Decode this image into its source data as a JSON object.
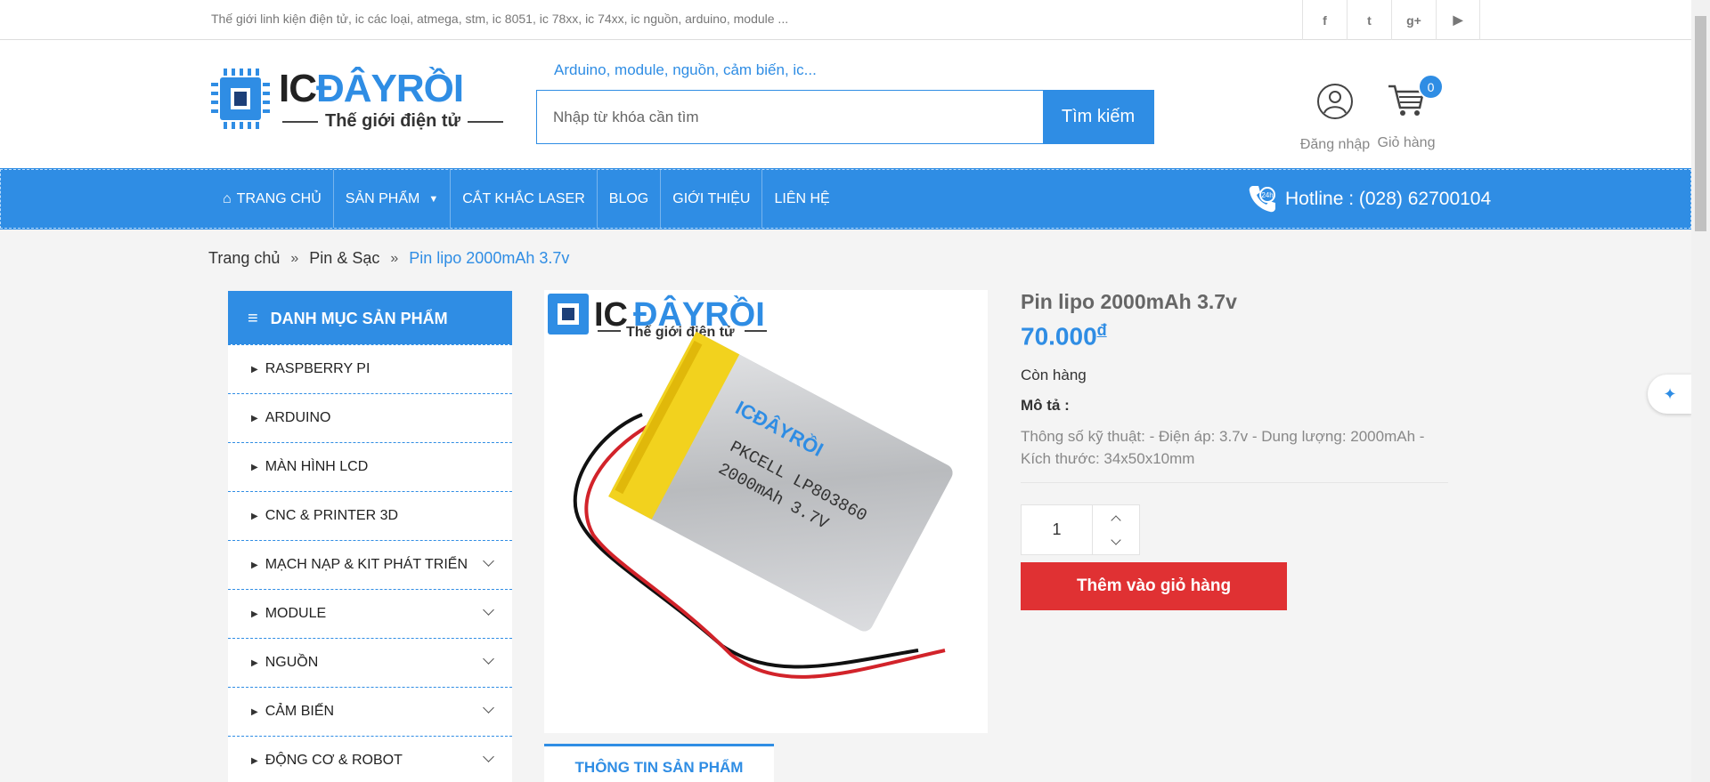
{
  "topbar": {
    "tagline": "Thế giới linh kiện điện tử, ic các loại, atmega, stm, ic 8051, ic 78xx, ic 74xx, ic nguồn, arduino, module ...",
    "social": [
      {
        "icon": "facebook-icon",
        "glyph": "f"
      },
      {
        "icon": "twitter-icon",
        "glyph": "t"
      },
      {
        "icon": "google-plus-icon",
        "glyph": "g+"
      },
      {
        "icon": "youtube-icon",
        "glyph": "▶"
      }
    ]
  },
  "logo": {
    "brand_ic": "IC",
    "brand_rest": "ĐÂYRỒI",
    "subtitle": "Thế giới điện tử"
  },
  "search": {
    "hint": "Arduino, module, nguồn, cảm biến, ic...",
    "placeholder": "Nhập từ khóa cần tìm",
    "button": "Tìm kiếm"
  },
  "account": {
    "label": "Đăng nhập"
  },
  "cart": {
    "label": "Giỏ hàng",
    "count": "0"
  },
  "nav": {
    "items": [
      "TRANG CHỦ",
      "SẢN PHẨM",
      "CẮT KHẮC LASER",
      "BLOG",
      "GIỚI THIỆU",
      "LIÊN HỆ"
    ],
    "hotline": "Hotline : (028) 62700104"
  },
  "breadcrumb": {
    "home": "Trang chủ",
    "category": "Pin & Sạc",
    "current": "Pin lipo 2000mAh 3.7v"
  },
  "sidebar": {
    "title": "DANH MỤC SẢN PHẨM",
    "categories": [
      {
        "label": "RASPBERRY PI",
        "expandable": false
      },
      {
        "label": "ARDUINO",
        "expandable": false
      },
      {
        "label": "MÀN HÌNH LCD",
        "expandable": false
      },
      {
        "label": "CNC & PRINTER 3D",
        "expandable": false
      },
      {
        "label": "MẠCH NẠP & KIT PHÁT TRIỂN",
        "expandable": true
      },
      {
        "label": "MODULE",
        "expandable": true
      },
      {
        "label": "NGUỒN",
        "expandable": true
      },
      {
        "label": "CẢM BIẾN",
        "expandable": true
      },
      {
        "label": "ĐỘNG CƠ & ROBOT",
        "expandable": true
      }
    ]
  },
  "product": {
    "name": "Pin lipo 2000mAh 3.7v",
    "price": "70.000",
    "currency": "đ",
    "stock": "Còn hàng",
    "desc_label": "Mô tả :",
    "description": "Thông số kỹ thuật: - Điện áp: 3.7v - Dung lượng: 2000mAh - Kích thước: 34x50x10mm",
    "quantity": "1",
    "add_to_cart": "Thêm vào giỏ hàng",
    "image_logo_sub": "Thế giới điện tử",
    "battery_text_1": "PKCELL LP803860",
    "battery_text_2": "2000mAh 3.7V"
  },
  "tabs": {
    "info": "THÔNG TIN SẢN PHẨM"
  },
  "colors": {
    "accent": "#2f8de4",
    "cta": "#e03133"
  }
}
